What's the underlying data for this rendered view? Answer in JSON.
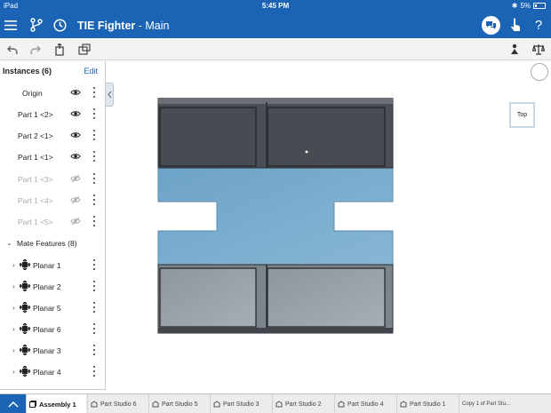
{
  "status_bar": {
    "device": "iPad",
    "time": "5:45 PM",
    "battery": "5%"
  },
  "header": {
    "doc_name": "TIE Fighter",
    "separator": " - ",
    "workspace": "Main",
    "icons": [
      "menu-icon",
      "branch-icon",
      "history-icon",
      "comments-icon",
      "touch-mode-icon",
      "help-icon"
    ],
    "help_label": "?"
  },
  "toolbar": {
    "icons": [
      "undo-icon",
      "redo-icon",
      "insert-part-icon",
      "mate-connector-icon",
      "measure-icon",
      "mass-properties-icon"
    ]
  },
  "instances": {
    "title": "Instances (6)",
    "edit_label": "Edit",
    "items": [
      {
        "label": "Origin",
        "visible": true
      },
      {
        "label": "Part 1 <2>",
        "visible": true
      },
      {
        "label": "Part 2 <1>",
        "visible": true
      },
      {
        "label": "Part 1 <1>",
        "visible": true
      },
      {
        "label": "Part 1 <3>",
        "visible": false
      },
      {
        "label": "Part 1 <4>",
        "visible": false
      },
      {
        "label": "Part 1 <5>",
        "visible": false
      }
    ],
    "mate_features": {
      "label": "Mate Features (8)",
      "items": [
        "Planar 1",
        "Planar 2",
        "Planar 5",
        "Planar 6",
        "Planar 3",
        "Planar 4"
      ]
    }
  },
  "viewport": {
    "view_cube_label": "Top"
  },
  "tabs": [
    {
      "label": "Assembly 1",
      "active": true
    },
    {
      "label": "Part Studio 6"
    },
    {
      "label": "Part Studio 5"
    },
    {
      "label": "Part Studio 3"
    },
    {
      "label": "Part Studio 2"
    },
    {
      "label": "Part Studio 4"
    },
    {
      "label": "Part Studio 1"
    },
    {
      "label": "Copy 1 of Part Stu..."
    }
  ],
  "colors": {
    "accent": "#1a63b5",
    "panel_blue": "#7aaccd",
    "dark_panel": "#464a50",
    "light_panel": "#9aa3ab"
  }
}
